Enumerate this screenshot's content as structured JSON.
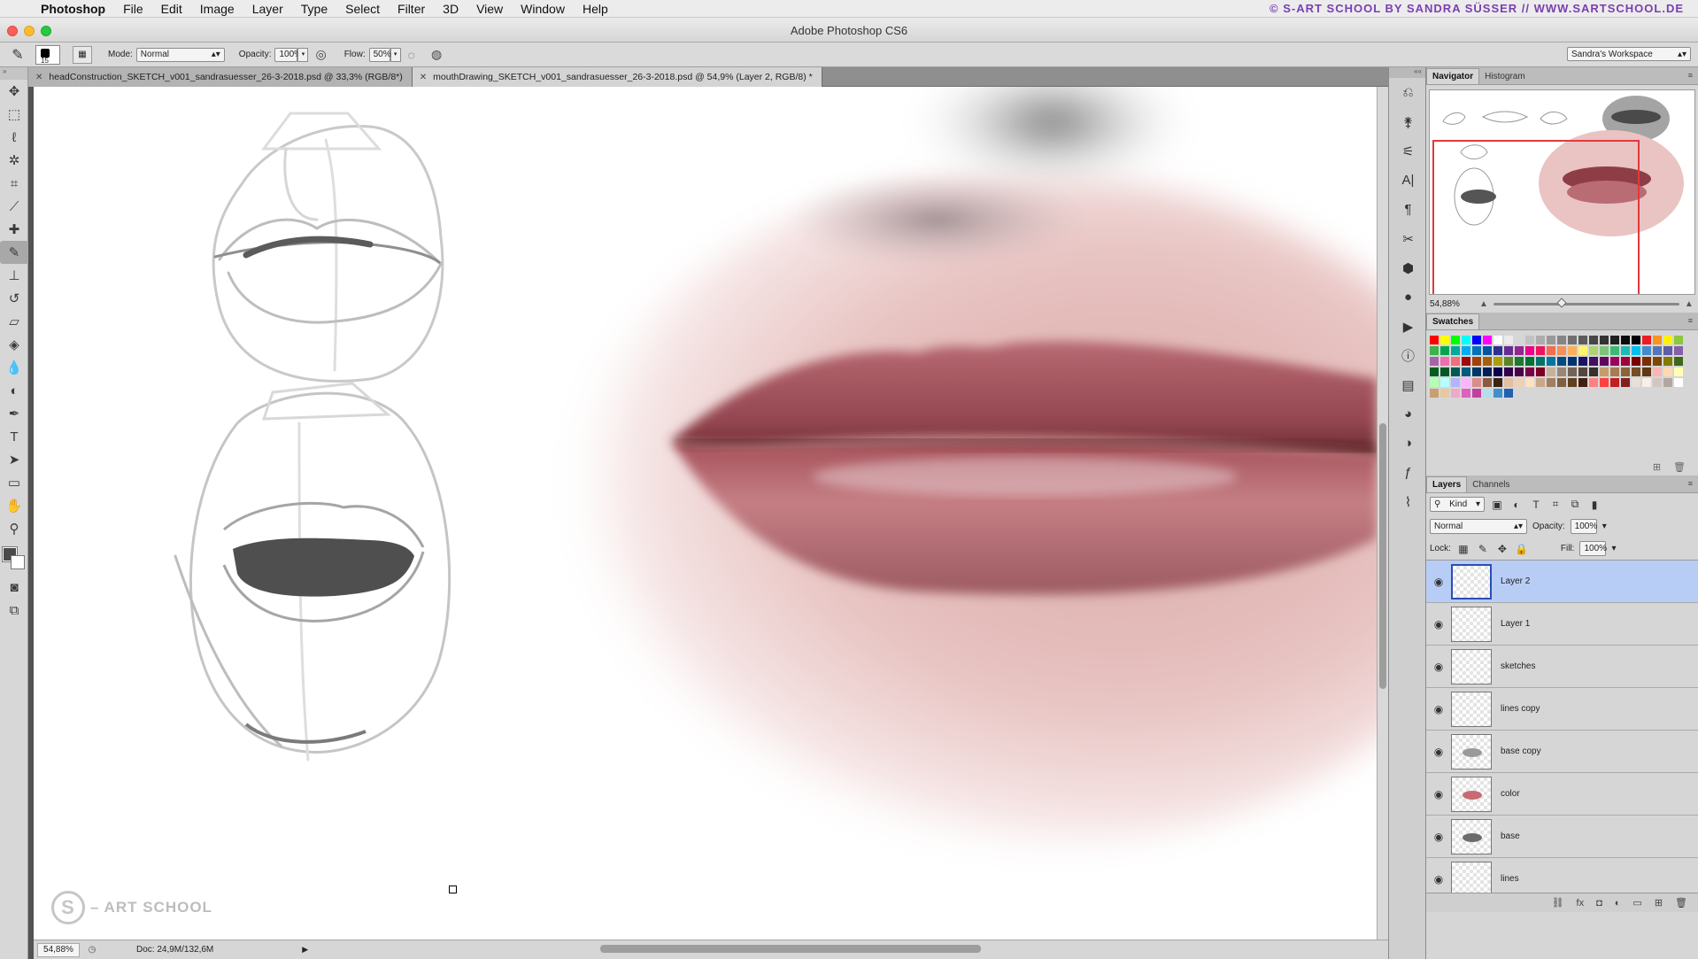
{
  "menubar": {
    "app": "Photoshop",
    "items": [
      "File",
      "Edit",
      "Image",
      "Layer",
      "Type",
      "Select",
      "Filter",
      "3D",
      "View",
      "Window",
      "Help"
    ],
    "credit": "© S-ART SCHOOL BY SANDRA SÜSSER // WWW.SARTSCHOOL.DE"
  },
  "window": {
    "title": "Adobe Photoshop CS6"
  },
  "options": {
    "brush_size": "15",
    "mode_label": "Mode:",
    "mode_value": "Normal",
    "opacity_label": "Opacity:",
    "opacity_value": "100%",
    "flow_label": "Flow:",
    "flow_value": "50%",
    "workspace": "Sandra's Workspace"
  },
  "tabs": [
    {
      "label": "headConstruction_SKETCH_v001_sandrasuesser_26-3-2018.psd @ 33,3% (RGB/8*)",
      "active": false
    },
    {
      "label": "mouthDrawing_SKETCH_v001_sandrasuesser_26-3-2018.psd @ 54,9% (Layer 2, RGB/8) *",
      "active": true
    }
  ],
  "canvas": {
    "watermark": "– ART SCHOOL",
    "watermark_letter": "S"
  },
  "status": {
    "zoom": "54,88%",
    "doc": "Doc: 24,9M/132,6M"
  },
  "navigator": {
    "tabs": [
      "Navigator",
      "Histogram"
    ],
    "zoom": "54,88%",
    "slider_fraction": 0.35
  },
  "swatches": {
    "title": "Swatches",
    "colors": [
      "#ff0000",
      "#ffff00",
      "#00ff00",
      "#00ffff",
      "#0000ff",
      "#ff00ff",
      "#ffffff",
      "#ebebeb",
      "#d6d6d6",
      "#c2c2c2",
      "#adadad",
      "#999999",
      "#858585",
      "#707070",
      "#5c5c5c",
      "#474747",
      "#333333",
      "#1f1f1f",
      "#0a0a0a",
      "#000000",
      "#ed1c24",
      "#f7941d",
      "#fff200",
      "#8dc63f",
      "#39b54a",
      "#00a651",
      "#00a99d",
      "#00aeef",
      "#0072bc",
      "#0054a6",
      "#2e3192",
      "#662d91",
      "#92278f",
      "#ec008c",
      "#ed145b",
      "#f26c4f",
      "#f68e56",
      "#fbaf5d",
      "#fff568",
      "#acd373",
      "#7cc576",
      "#3cb878",
      "#1cbbb4",
      "#00bff3",
      "#448ccb",
      "#5674b9",
      "#605ca8",
      "#8560a8",
      "#a864a8",
      "#f06ea9",
      "#f26d7d",
      "#9e0b0f",
      "#a0410d",
      "#a36209",
      "#aba000",
      "#598527",
      "#1a7b30",
      "#007236",
      "#00746b",
      "#0076a3",
      "#004b80",
      "#003471",
      "#1b1464",
      "#440e62",
      "#630460",
      "#9e005d",
      "#9e0039",
      "#790000",
      "#7b2e00",
      "#7d4900",
      "#827b00",
      "#406618",
      "#005e20",
      "#005826",
      "#005952",
      "#005b7f",
      "#003663",
      "#002157",
      "#0d004c",
      "#32004b",
      "#4b0049",
      "#7b0046",
      "#7a0026",
      "#c7b299",
      "#998675",
      "#736357",
      "#534741",
      "#37302d",
      "#c69c6d",
      "#a67c52",
      "#8c6239",
      "#754c24",
      "#603913",
      "#ffb3b3",
      "#ffd9b3",
      "#ffffb3",
      "#b3ffb3",
      "#b3ffff",
      "#b3b3ff",
      "#ffb3ff",
      "#d98c8c",
      "#8c5a3c",
      "#3c2414",
      "#e0c0a0",
      "#f0d0b0",
      "#ffe0c0",
      "#c8a888",
      "#a08060",
      "#806040",
      "#604020",
      "#402010",
      "#ff8080",
      "#ff4040",
      "#c02020",
      "#802020",
      "#e8e0d8",
      "#f8f0e8",
      "#d0c8c0",
      "#b0a8a0",
      "#ffffff",
      "#c8a070",
      "#e8c8a0",
      "#f0a8c8",
      "#e060c0",
      "#c040a0",
      "#b0e0f0",
      "#4090d0",
      "#2060b0"
    ]
  },
  "layers_panel": {
    "tabs": [
      "Layers",
      "Channels"
    ],
    "kind": "Kind",
    "blend": "Normal",
    "opacity_label": "Opacity:",
    "opacity": "100%",
    "lock_label": "Lock:",
    "fill_label": "Fill:",
    "fill": "100%",
    "layers": [
      {
        "name": "Layer 2",
        "selected": true,
        "thumb": ""
      },
      {
        "name": "Layer 1",
        "selected": false,
        "thumb": ""
      },
      {
        "name": "sketches",
        "selected": false,
        "thumb": ""
      },
      {
        "name": "lines copy",
        "selected": false,
        "thumb": ""
      },
      {
        "name": "base copy",
        "selected": false,
        "thumb": "#9a9a9a"
      },
      {
        "name": "color",
        "selected": false,
        "thumb": "#c86a72"
      },
      {
        "name": "base",
        "selected": false,
        "thumb": "#6c6c6c"
      },
      {
        "name": "lines",
        "selected": false,
        "thumb": ""
      }
    ]
  },
  "colors": {
    "accent": "#b8cdf6",
    "nav_frame": "#e23a3a"
  }
}
